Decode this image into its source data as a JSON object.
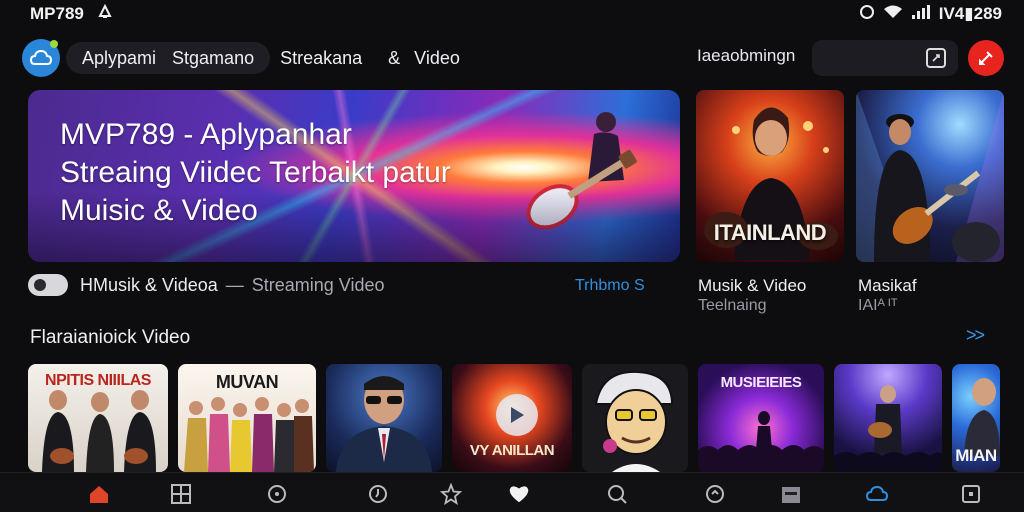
{
  "status_bar": {
    "app_name": "MP789",
    "right_text": "IV4▮289"
  },
  "header": {
    "nav": [
      "Aplypami",
      "Stgamano",
      "Streakana",
      "Video"
    ],
    "nav_separator": "&",
    "right_label": "Iaeaobmingn"
  },
  "hero": {
    "title_lines": [
      "MVP789 - Aplypanhar",
      "Streaing Viidec Terbaikt patur",
      "Muisic & Video"
    ],
    "caption_main": "HMusik & Videoa",
    "caption_dash": "—",
    "caption_sub": "Streaming Video",
    "trending_label": "Trhbmo S  "
  },
  "side_cards": [
    {
      "overlay": "ITAINLAND",
      "title": "Musik & Video",
      "subtitle": "Teelnaing"
    },
    {
      "overlay": "",
      "title": "Masikaf",
      "subtitle": "IAIᴬ ᴵᵀ"
    }
  ],
  "section": {
    "title": "Flaraianioick Video",
    "more": ">>"
  },
  "thumbnails": [
    {
      "overlay": "NPITIS NIIILAS"
    },
    {
      "overlay": "MUVAN"
    },
    {
      "overlay": ""
    },
    {
      "overlay": "VY ANILLAN"
    },
    {
      "overlay": ""
    },
    {
      "overlay": "MUSIEIEIES"
    },
    {
      "overlay": ""
    },
    {
      "overlay": "MIAN"
    }
  ],
  "colors": {
    "accent_blue": "#2e8fe0",
    "profile_red": "#e8241f",
    "home_active": "#e0452a"
  },
  "bottom_nav_icons": [
    "home-icon",
    "grid-icon",
    "compass-icon",
    "clock-icon",
    "star-icon",
    "heart-icon",
    "search-icon",
    "refresh-icon",
    "calendar-icon",
    "cloud-icon",
    "square-icon"
  ]
}
